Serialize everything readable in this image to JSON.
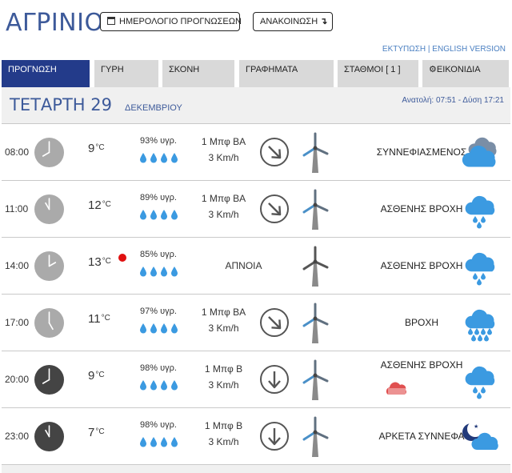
{
  "header": {
    "city": "ΑΓΡΙΝΙΟ",
    "calendar_button": "ΗΜΕΡΟΛΟΓΙΟ ΠΡΟΓΝΩΣΕΩΝ",
    "announcement_button": "ΑΝΑΚΟΙΝΩΣΗ",
    "announcement_arrow": "↴",
    "print_link": "ΕΚΤΥΠΩΣΗ",
    "separator": " | ",
    "english_link": "ENGLISH VERSION"
  },
  "tabs": [
    {
      "label": "ΠΡΟΓΝΩΣΗ",
      "active": true
    },
    {
      "label": "ΓΥΡΗ",
      "active": false
    },
    {
      "label": "ΣΚΟΝΗ",
      "active": false
    },
    {
      "label": "ΓΡΑΦΗΜΑΤΑ",
      "active": false
    },
    {
      "label": "ΣΤΑΘΜΟΙ  [ 1 ]",
      "active": false
    },
    {
      "label": "ΕΙΚΟΝΙΔΙΑ",
      "active": false,
      "icon": "gear-icon"
    }
  ],
  "day": {
    "name": "ΤΕΤΑΡΤΗ 29",
    "month": "ΔΕΚΕΜΒΡΙΟΥ",
    "sun": "Ανατολή: 07:51  - Δύση 17:21"
  },
  "colors": {
    "brand": "#3d5a9a",
    "active_tab": "#233b8a",
    "tab": "#d9d9d9",
    "drop": "#3b9ae1",
    "day_clock": "#aaaaaa",
    "night_clock": "#444444",
    "hot_dot": "#e01010"
  },
  "forecast": [
    {
      "time": "08:00",
      "hour": 8,
      "night": false,
      "temp": "9",
      "unit": "°C",
      "hot": false,
      "humidity": "93% υγρ.",
      "drops": 4,
      "wind1": "1 Μπφ ΒΑ",
      "wind2": "3 Km/h",
      "calm": "",
      "arrow": "NE",
      "condition": "ΣΥΝΝΕΦΙΑΣΜΕΝΟΣ",
      "icon": "cloudy-icon"
    },
    {
      "time": "11:00",
      "hour": 11,
      "night": false,
      "temp": "12",
      "unit": "°C",
      "hot": false,
      "humidity": "89% υγρ.",
      "drops": 4,
      "wind1": "1 Μπφ ΒΑ",
      "wind2": "3 Km/h",
      "calm": "",
      "arrow": "NE",
      "condition": "ΑΣΘΕΝΗΣ ΒΡΟΧΗ",
      "icon": "light-rain-icon"
    },
    {
      "time": "14:00",
      "hour": 14,
      "night": false,
      "temp": "13",
      "unit": "°C",
      "hot": true,
      "humidity": "85% υγρ.",
      "drops": 4,
      "wind1": "",
      "wind2": "",
      "calm": "ΑΠΝΟΙΑ",
      "arrow": "",
      "condition": "ΑΣΘΕΝΗΣ ΒΡΟΧΗ",
      "icon": "light-rain-icon"
    },
    {
      "time": "17:00",
      "hour": 17,
      "night": false,
      "temp": "11",
      "unit": "°C",
      "hot": false,
      "humidity": "97% υγρ.",
      "drops": 4,
      "wind1": "1 Μπφ ΒΑ",
      "wind2": "3 Km/h",
      "calm": "",
      "arrow": "NE",
      "condition": "ΒΡΟΧΗ",
      "icon": "rain-icon"
    },
    {
      "time": "20:00",
      "hour": 20,
      "night": true,
      "temp": "9",
      "unit": "°C",
      "hot": false,
      "humidity": "98% υγρ.",
      "drops": 4,
      "wind1": "1 Μπφ Β",
      "wind2": "3 Km/h",
      "calm": "",
      "arrow": "N",
      "condition": "ΑΣΘΕΝΗΣ ΒΡΟΧΗ",
      "icon": "light-rain-icon",
      "alert_icon": "red-cloud-icon"
    },
    {
      "time": "23:00",
      "hour": 23,
      "night": true,
      "temp": "7",
      "unit": "°C",
      "hot": false,
      "humidity": "98% υγρ.",
      "drops": 4,
      "wind1": "1 Μπφ Β",
      "wind2": "3 Km/h",
      "calm": "",
      "arrow": "N",
      "condition": "ΑΡΚΕΤΑ ΣΥΝΝΕΦΑ",
      "icon": "moon-cloudy-icon"
    }
  ]
}
